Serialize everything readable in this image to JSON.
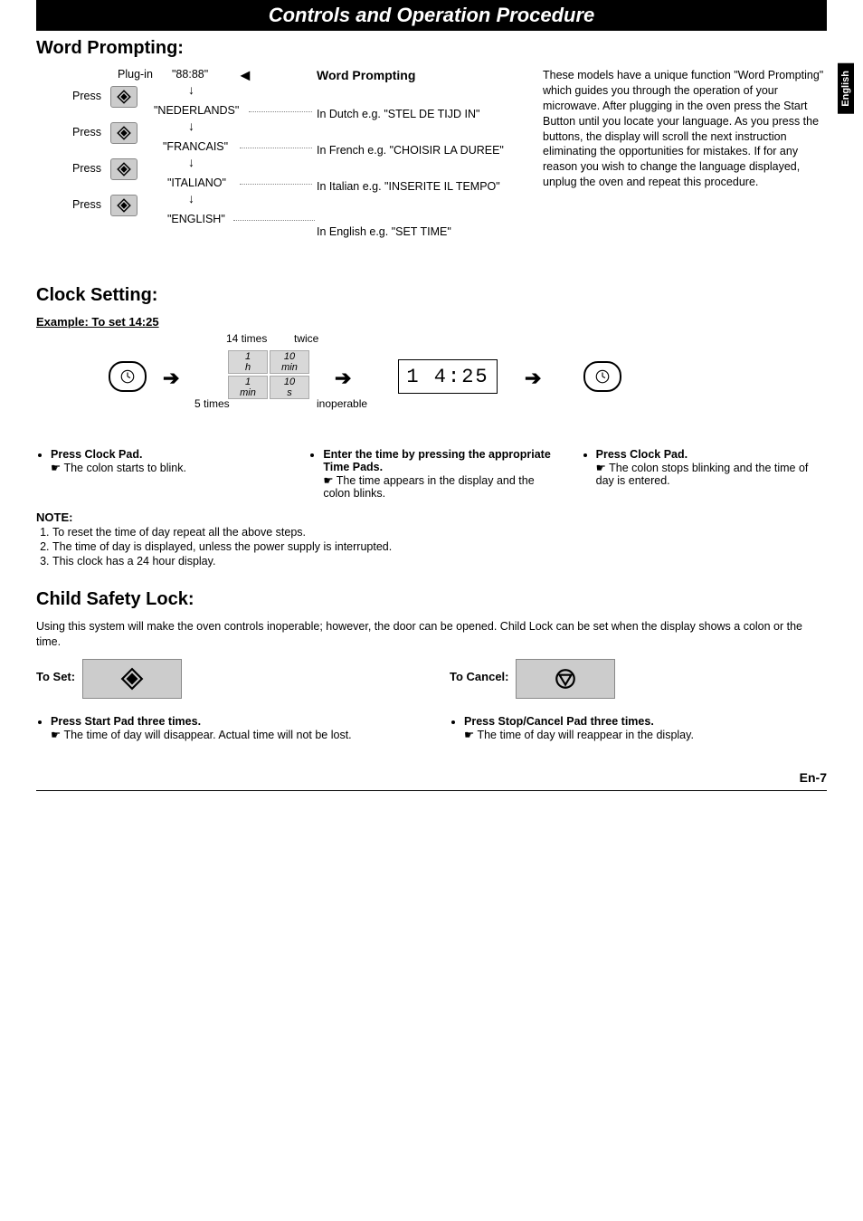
{
  "banner": "Controls and Operation Procedure",
  "sideTab": "English",
  "wordPrompting": {
    "heading": "Word Prompting:",
    "plugIn": "Plug-in",
    "initialDisplay": "\"88:88\"",
    "pressLabel": "Press",
    "title": "Word Prompting",
    "langs": [
      {
        "name": "\"NEDERLANDS\"",
        "desc": "In Dutch e.g. \"STEL DE TIJD IN\""
      },
      {
        "name": "\"FRANCAIS\"",
        "desc": "In French e.g. \"CHOISIR LA DUREE\""
      },
      {
        "name": "\"ITALIANO\"",
        "desc": "In Italian e.g. \"INSERITE IL TEMPO\""
      },
      {
        "name": "\"ENGLISH\"",
        "desc": "In English e.g. \"SET TIME\""
      }
    ],
    "explain": "These models have a unique function \"Word Prompting\" which guides you through the operation of your microwave. After plugging in the oven press the Start Button until you locate your language. As you press the buttons, the display will scroll the next instruction eliminating the opportunities for mistakes. If for any reason you wish to change the language displayed, unplug the oven and repeat this procedure."
  },
  "clock": {
    "heading": "Clock Setting:",
    "example": "Example: To set 14:25",
    "count14": "14 times",
    "countTwice": "twice",
    "count5": "5 times",
    "inoperable": "inoperable",
    "grid": {
      "r1c1": "1",
      "r1c2": "10",
      "r2c1": "h",
      "r2c2": "min",
      "r3c1": "1",
      "r3c2": "10",
      "r4c1": "min",
      "r4c2": "s"
    },
    "displayValue": "1 4:25",
    "steps": [
      {
        "lead": "Press Clock Pad.",
        "sub": "The colon starts to blink."
      },
      {
        "lead": "Enter the time by pressing the appropriate Time Pads.",
        "sub": "The time appears in the display and the colon blinks."
      },
      {
        "lead": "Press Clock Pad.",
        "sub": "The colon stops blinking and the time of day is entered."
      }
    ],
    "noteHead": "NOTE:",
    "notes": [
      "To reset the time of day repeat all the above steps.",
      "The time of day is displayed, unless the power supply is interrupted.",
      "This clock has a 24 hour display."
    ]
  },
  "childLock": {
    "heading": "Child Safety Lock:",
    "intro": "Using this system will make the oven controls inoperable; however, the door can be opened. Child Lock can be set when the display shows a colon or the time.",
    "toSet": "To Set:",
    "toCancel": "To Cancel:",
    "setLead": "Press Start Pad three times.",
    "setSub": "The time of day will disappear. Actual time will not be lost.",
    "cancelLead": "Press Stop/Cancel Pad three times.",
    "cancelSub": "The time of day will reappear in the display."
  },
  "pageNum": "En-7"
}
